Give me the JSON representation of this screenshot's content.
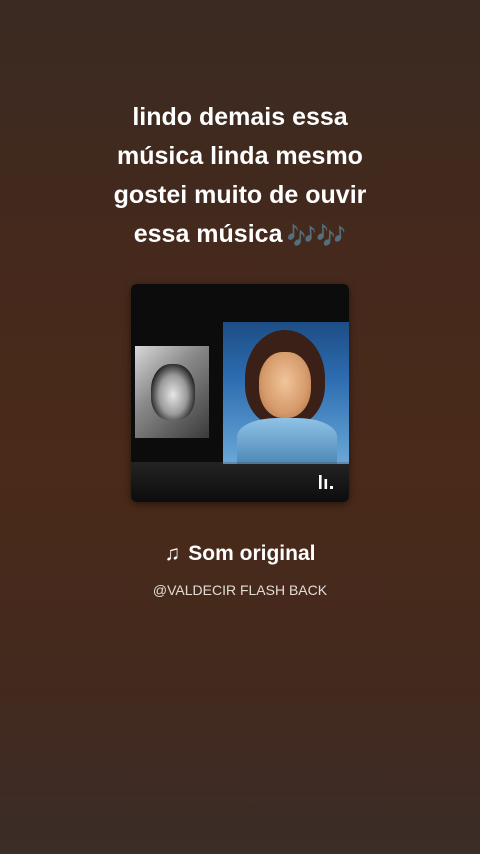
{
  "caption": {
    "lines": [
      "lindo demais essa",
      "música linda mesmo",
      "gostei muito de ouvir",
      "essa música"
    ],
    "emoji": "🎶🎶"
  },
  "cover": {
    "alt": "album-cover-photos",
    "badge_icon": "audio-bars-icon"
  },
  "sound": {
    "note_icon": "♫",
    "title": "Som original",
    "author": "@VALDECIR FLASH BACK"
  },
  "colors": {
    "background_top": "#3a2a22",
    "background_mid": "#4a2a19",
    "text": "#ffffff",
    "emoji": "#a27ad8"
  }
}
